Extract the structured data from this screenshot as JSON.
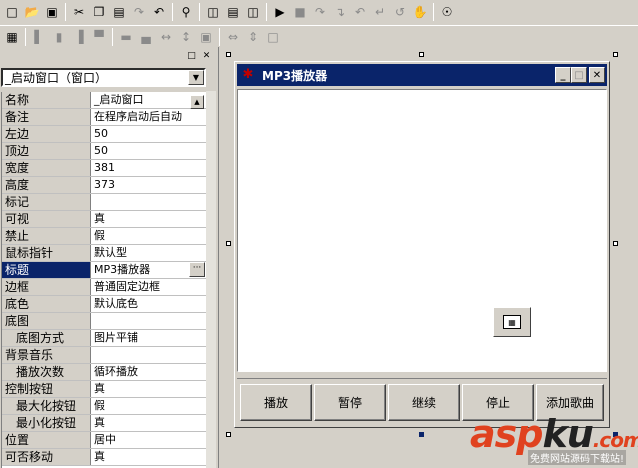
{
  "toolbar1": {
    "icons": [
      "new-file-icon",
      "open-folder-icon",
      "save-icon",
      "cut-icon",
      "copy-icon",
      "paste-icon",
      "redo-icon",
      "undo-icon",
      "find-icon",
      "layout-icon",
      "window-icon",
      "split-window-icon",
      "run-icon",
      "stop-icon",
      "step-icon",
      "step-into-icon",
      "step-over-icon",
      "step-out-icon",
      "breakpoint-icon",
      "hand-icon",
      "watch-icon"
    ]
  },
  "toolbar2": {
    "icons": [
      "properties-icon",
      "align-left-icon",
      "align-center-icon",
      "align-right-icon",
      "align-top-icon",
      "align-middle-icon",
      "align-bottom-icon",
      "space-horizontal-icon",
      "space-vertical-icon",
      "center-icon",
      "same-width-icon",
      "same-height-icon",
      "same-size-icon"
    ]
  },
  "panel": {
    "selected_object": "_启动窗口（窗口）",
    "properties": [
      {
        "name": "名称",
        "value": "_启动窗口",
        "sub": false
      },
      {
        "name": "备注",
        "value": "在程序启动后自动",
        "sub": false
      },
      {
        "name": "左边",
        "value": "50",
        "sub": false
      },
      {
        "name": "顶边",
        "value": "50",
        "sub": false
      },
      {
        "name": "宽度",
        "value": "381",
        "sub": false
      },
      {
        "name": "高度",
        "value": "373",
        "sub": false
      },
      {
        "name": "标记",
        "value": "",
        "sub": false
      },
      {
        "name": "可视",
        "value": "真",
        "sub": false
      },
      {
        "name": "禁止",
        "value": "假",
        "sub": false
      },
      {
        "name": "鼠标指针",
        "value": "默认型",
        "sub": false
      },
      {
        "name": "标题",
        "value": "MP3播放器",
        "sub": false,
        "selected": true
      },
      {
        "name": "边框",
        "value": "普通固定边框",
        "sub": false
      },
      {
        "name": "底色",
        "value": "默认底色",
        "sub": false
      },
      {
        "name": "底图",
        "value": "",
        "sub": false
      },
      {
        "name": "底图方式",
        "value": "图片平铺",
        "sub": true
      },
      {
        "name": "背景音乐",
        "value": "",
        "sub": false
      },
      {
        "name": "播放次数",
        "value": "循环播放",
        "sub": true
      },
      {
        "name": "控制按钮",
        "value": "真",
        "sub": false
      },
      {
        "name": "最大化按钮",
        "value": "假",
        "sub": true
      },
      {
        "name": "最小化按钮",
        "value": "真",
        "sub": true
      },
      {
        "name": "位置",
        "value": "居中",
        "sub": false
      },
      {
        "name": "可否移动",
        "value": "真",
        "sub": false
      }
    ]
  },
  "form": {
    "title": "MP3播放器",
    "buttons": [
      "播放",
      "暂停",
      "继续",
      "停止",
      "添加歌曲"
    ]
  },
  "watermark": {
    "logo_a": "asp",
    "logo_b": "ku",
    "logo_c": ".com",
    "subtitle": "免费网站源码下载站!"
  },
  "colors": {
    "title_bar": "#0a246a",
    "face": "#d4d0c8",
    "watermark_red": "#e0421f"
  }
}
